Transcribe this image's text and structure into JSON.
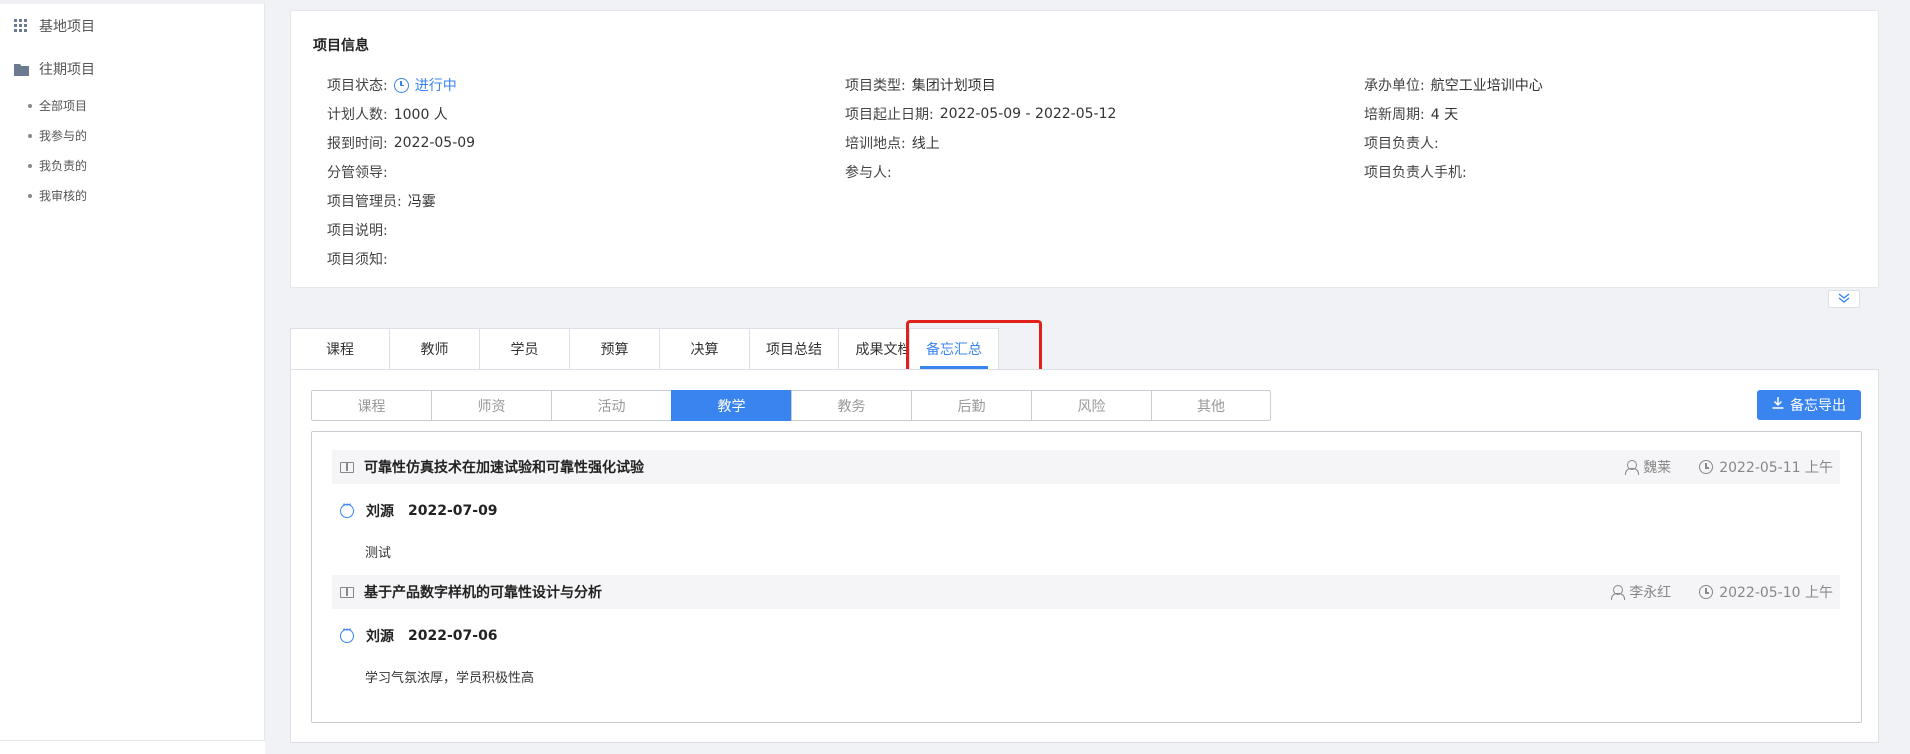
{
  "sidebar": {
    "groups": [
      {
        "label": "基地项目",
        "icon": "grid-icon"
      },
      {
        "label": "往期项目",
        "icon": "folder-icon"
      }
    ],
    "sub_items": [
      "全部项目",
      "我参与的",
      "我负责的",
      "我审核的"
    ]
  },
  "info": {
    "title": "项目信息",
    "status_label": "项目状态:",
    "status_value": "进行中",
    "col1": [
      {
        "label": "计划人数:",
        "value": "1000 人"
      },
      {
        "label": "报到时间:",
        "value": "2022-05-09"
      },
      {
        "label": "分管领导:",
        "value": ""
      },
      {
        "label": "项目管理员:",
        "value": "冯霎"
      },
      {
        "label": "项目说明:",
        "value": ""
      },
      {
        "label": "项目须知:",
        "value": ""
      }
    ],
    "col2": [
      {
        "label": "项目类型:",
        "value": "集团计划项目"
      },
      {
        "label": "项目起止日期:",
        "value": "2022-05-09 - 2022-05-12"
      },
      {
        "label": "培训地点:",
        "value": "线上"
      },
      {
        "label": "参与人:",
        "value": ""
      }
    ],
    "col3": [
      {
        "label": "承办单位:",
        "value": "航空工业培训中心"
      },
      {
        "label": "培新周期:",
        "value": "4 天"
      },
      {
        "label": "项目负责人:",
        "value": ""
      },
      {
        "label": "项目负责人手机:",
        "value": ""
      }
    ]
  },
  "main_tabs": [
    "课程",
    "教师",
    "学员",
    "预算",
    "决算",
    "项目总结",
    "成果文档",
    "备忘汇总"
  ],
  "main_tab_active": "备忘汇总",
  "sub_tabs": [
    "课程",
    "师资",
    "活动",
    "教学",
    "教务",
    "后勤",
    "风险",
    "其他"
  ],
  "sub_tab_active": "教学",
  "export_label": "备忘导出",
  "memos": [
    {
      "title": "可靠性仿真技术在加速试验和可靠性强化试验",
      "author": "魏莱",
      "time": "2022-05-11 上午",
      "comment_author": "刘源",
      "comment_date": "2022-07-09",
      "comment_text": "测试"
    },
    {
      "title": "基于产品数字样机的可靠性设计与分析",
      "author": "李永红",
      "time": "2022-05-10 上午",
      "comment_author": "刘源",
      "comment_date": "2022-07-06",
      "comment_text": "学习气氛浓厚，学员积极性高"
    }
  ],
  "colors": {
    "accent": "#3a84f0",
    "highlight": "#e0201b"
  }
}
